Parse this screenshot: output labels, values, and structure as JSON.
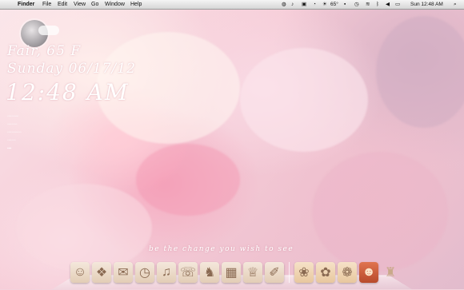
{
  "menubar": {
    "apple_glyph": "",
    "menus": [
      "Finder",
      "File",
      "Edit",
      "View",
      "Go",
      "Window",
      "Help"
    ],
    "status": {
      "temperature": "65°",
      "clock": "Sun 12:48 AM"
    }
  },
  "widgets": {
    "weather": "Fair, 65 F",
    "date": "Sunday 06/17/12",
    "time": "12:48 AM"
  },
  "quote": "be the change you wish to see",
  "dock": {
    "items": [
      {
        "name": "finder",
        "glyph": "☺"
      },
      {
        "name": "photos",
        "glyph": "❖"
      },
      {
        "name": "mail",
        "glyph": "✉"
      },
      {
        "name": "clock",
        "glyph": "◷"
      },
      {
        "name": "music",
        "glyph": "♫"
      },
      {
        "name": "messages",
        "glyph": "☏"
      },
      {
        "name": "chess",
        "glyph": "♞"
      },
      {
        "name": "calendar",
        "glyph": "▦"
      },
      {
        "name": "dress",
        "glyph": "♕"
      },
      {
        "name": "preview",
        "glyph": "✐"
      }
    ],
    "right_items": [
      {
        "name": "folder-1",
        "glyph": "❀"
      },
      {
        "name": "folder-2",
        "glyph": "✿"
      },
      {
        "name": "folder-3",
        "glyph": "❁"
      },
      {
        "name": "portrait",
        "glyph": "☻"
      },
      {
        "name": "trash",
        "glyph": "♜"
      }
    ]
  },
  "colors": {
    "wallpaper_pink": "#f3d3dd",
    "text_white": "#ffffff"
  }
}
